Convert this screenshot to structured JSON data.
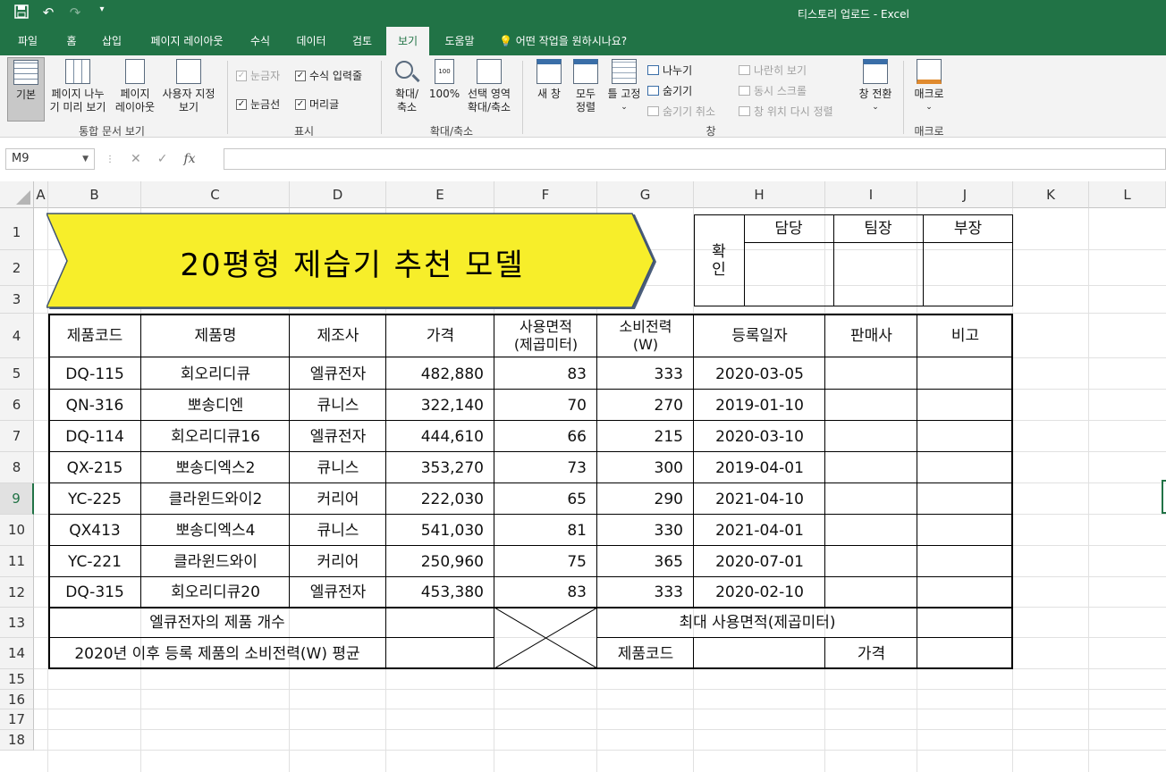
{
  "window": {
    "title": "티스토리 업로드  -  Excel",
    "qat": {
      "save_icon": "save-icon",
      "undo_icon": "undo-icon",
      "redo_icon": "redo-icon",
      "customize_icon": "customize-qat-icon"
    }
  },
  "tabs": [
    {
      "label": "파일"
    },
    {
      "label": "홈"
    },
    {
      "label": "삽입"
    },
    {
      "label": "페이지 레이아웃"
    },
    {
      "label": "수식"
    },
    {
      "label": "데이터"
    },
    {
      "label": "검토"
    },
    {
      "label": "보기",
      "active": true
    },
    {
      "label": "도움말"
    }
  ],
  "tell_me": "어떤 작업을 원하시나요?",
  "ribbon": {
    "workbook_views": {
      "label": "통합 문서 보기",
      "normal": "기본",
      "page_break_1": "페이지 나누",
      "page_break_2": "기 미리 보기",
      "page_layout_1": "페이지",
      "page_layout_2": "레이아웃",
      "custom_1": "사용자 지정",
      "custom_2": "보기"
    },
    "show": {
      "label": "표시",
      "ruler": "눈금자",
      "formula_bar": "수식 입력줄",
      "gridlines": "눈금선",
      "headings": "머리글"
    },
    "zoom": {
      "label": "확대/축소",
      "zoom_1": "확대/",
      "zoom_2": "축소",
      "zoom100": "100%",
      "zoom_sel_1": "선택 영역",
      "zoom_sel_2": "확대/축소"
    },
    "window": {
      "label": "창",
      "new_window": "새 창",
      "arrange_1": "모두",
      "arrange_2": "정렬",
      "freeze": "틀 고정",
      "split": "나누기",
      "hide": "숨기기",
      "unhide": "숨기기 취소",
      "side_by_side": "나란히 보기",
      "sync_scroll": "동시 스크롤",
      "reset_pos": "창 위치 다시 정렬",
      "switch": "창 전환"
    },
    "macros": {
      "label": "매크로",
      "macros": "매크로"
    }
  },
  "formula_bar": {
    "name_box": "M9",
    "formula": ""
  },
  "columns": [
    "A",
    "B",
    "C",
    "D",
    "E",
    "F",
    "G",
    "H",
    "I",
    "J",
    "K",
    "L"
  ],
  "rows": [
    "1",
    "2",
    "3",
    "4",
    "5",
    "6",
    "7",
    "8",
    "9",
    "10",
    "11",
    "12",
    "13",
    "14",
    "15",
    "16",
    "17",
    "18"
  ],
  "selected_row": "9",
  "sheet": {
    "title": "20평형 제습기 추천 모델",
    "approval": {
      "label": "확\n인",
      "c1": "담당",
      "c2": "팀장",
      "c3": "부장"
    },
    "headers": [
      "제품코드",
      "제품명",
      "제조사",
      "가격",
      "사용면적\n(제곱미터)",
      "소비전력\n(W)",
      "등록일자",
      "판매사",
      "비고"
    ],
    "data": [
      [
        "DQ-115",
        "회오리디큐",
        "엘큐전자",
        "482,880",
        "83",
        "333",
        "2020-03-05",
        "",
        ""
      ],
      [
        "QN-316",
        "뽀송디엔",
        "큐니스",
        "322,140",
        "70",
        "270",
        "2019-01-10",
        "",
        ""
      ],
      [
        "DQ-114",
        "회오리디큐16",
        "엘큐전자",
        "444,610",
        "66",
        "215",
        "2020-03-10",
        "",
        ""
      ],
      [
        "QX-215",
        "뽀송디엑스2",
        "큐니스",
        "353,270",
        "73",
        "300",
        "2019-04-01",
        "",
        ""
      ],
      [
        "YC-225",
        "클라윈드와이2",
        "커리어",
        "222,030",
        "65",
        "290",
        "2021-04-10",
        "",
        ""
      ],
      [
        "QX413",
        "뽀송디엑스4",
        "큐니스",
        "541,030",
        "81",
        "330",
        "2021-04-01",
        "",
        ""
      ],
      [
        "YC-221",
        "클라윈드와이",
        "커리어",
        "250,960",
        "75",
        "365",
        "2020-07-01",
        "",
        ""
      ],
      [
        "DQ-315",
        "회오리디큐20",
        "엘큐전자",
        "453,380",
        "83",
        "333",
        "2020-02-10",
        "",
        ""
      ]
    ],
    "summary": {
      "r13_label": "엘큐전자의 제품 개수",
      "r14_label": "2020년 이후 등록 제품의 소비전력(W) 평균",
      "max_area_label": "최대 사용면적(제곱미터)",
      "code_label": "제품코드",
      "price_label": "가격"
    }
  }
}
